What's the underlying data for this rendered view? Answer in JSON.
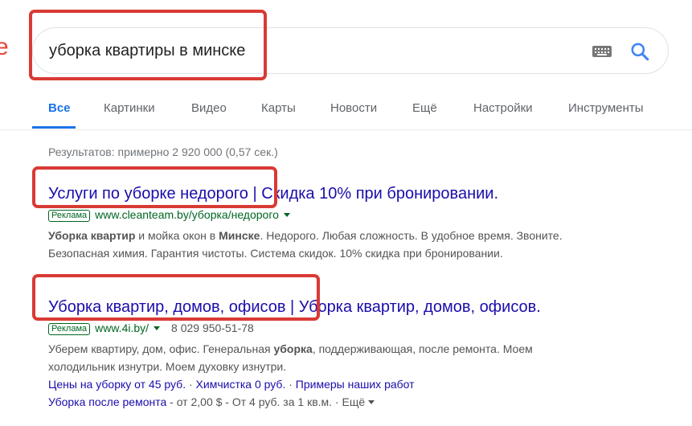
{
  "logo_fragment": "e",
  "search": {
    "query": "уборка квартиры в минске"
  },
  "tabs": [
    {
      "label": "Все"
    },
    {
      "label": "Картинки"
    },
    {
      "label": "Видео"
    },
    {
      "label": "Карты"
    },
    {
      "label": "Новости"
    },
    {
      "label": "Ещё"
    },
    {
      "label": "Настройки"
    },
    {
      "label": "Инструменты"
    }
  ],
  "stats": "Результатов: примерно 2 920 000 (0,57 сек.)",
  "ads": [
    {
      "title": "Услуги по уборке недорого | Скидка 10% при бронировании.",
      "badge": "Реклама",
      "url": "www.cleanteam.by/уборка/недорого",
      "desc_line1": {
        "b1": "Уборка квартир",
        "t1": " и мойка окон в ",
        "b2": "Минске",
        "t2": ". Недорого. Любая сложность. В удобное время. Звоните."
      },
      "desc_line2": "Безопасная химия. Гарантия чистоты. Система скидок. 10% скидка при бронировании."
    },
    {
      "title": "Уборка квартир, домов, офисов | Уборка квартир, домов, офисов.",
      "badge": "Реклама",
      "url": "www.4i.by/",
      "phone": "8 029 950-51-78",
      "desc_line1": {
        "t1": "Уберем квартиру, дом, офис. Генеральная ",
        "b1": "уборка",
        "t2": ", поддерживающая, после ремонта. Моем"
      },
      "desc_line2": "холодильник изнутри. Моем духовку изнутри.",
      "sitelinks": [
        "Цены на уборку от 45 руб.",
        "Химчистка 0 руб.",
        "Примеры наших работ"
      ],
      "sitelink_sep": " · ",
      "extra": {
        "link": "Уборка после ремонта",
        "text": " - от 2,00 $ - От 4 руб. за 1 кв.м. · ",
        "more": "Ещё"
      }
    }
  ]
}
